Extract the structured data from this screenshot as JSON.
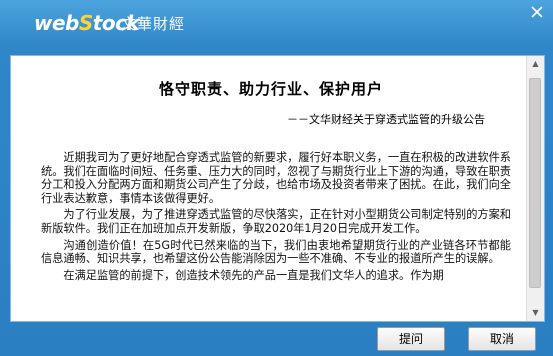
{
  "app": {
    "logo_main": "web",
    "logo_s": "S",
    "logo_rest": "tock",
    "subtitle": "文華財經"
  },
  "document": {
    "title": "恪守职责、助力行业、保护用户",
    "subtitle": "－－文华财经关于穿透式监管的升级公告",
    "paragraphs": [
      "近期我司为了更好地配合穿透式监管的新要求，履行好本职义务，一直在积极的改进软件系统。我们在面临时间短、任务重、压力大的同时，忽视了与期货行业上下游的沟通，导致在职责分工和投入分配两方面和期货公司产生了分歧，也给市场及投资者带来了困扰。在此，我们向全行业表达歉意，事情本该做得更好。",
      "为了行业发展，为了推进穿透式监管的尽快落实，正在针对小型期货公司制定特别的方案和新版软件。我们正在加班加点开发新版，争取2020年1月20日完成开发工作。",
      "沟通创造价值！在5G时代已然来临的当下，我们由衷地希望期货行业的产业链各环节都能信息通畅、知识共享，也希望这份公告能消除因为一些不准确、不专业的报道所产生的误解。",
      "在满足监管的前提下，创造技术领先的产品一直是我们文华人的追求。作为期"
    ]
  },
  "buttons": {
    "ask": "提问",
    "cancel": "取消"
  },
  "colors": {
    "window_blue": "#2f87c9",
    "logo_accent": "#ffd23a"
  },
  "icons": {
    "close": "close-icon",
    "scroll_up": "chevron-up-icon",
    "scroll_down": "chevron-down-icon"
  }
}
